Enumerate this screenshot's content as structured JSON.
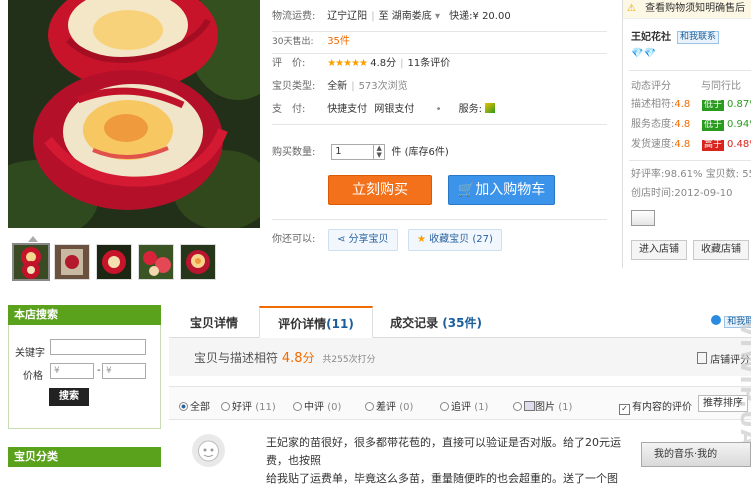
{
  "product": {
    "shipping_label": "物流运费:",
    "shipping_from": "辽宁辽阳",
    "shipping_to_prefix": "至",
    "shipping_to": "湖南娄底",
    "shipping_to_arrow": "▾",
    "shipping_express": "快递:¥ 20.00",
    "sold_label": "30天售出:",
    "sold_value": "35件",
    "rating_label": "评　价:",
    "rating_stars": "★★★★★",
    "rating_score": "4.8分",
    "rating_count": "11条评价",
    "type_label": "宝贝类型:",
    "type_value": "全新",
    "views": "573次浏览",
    "pay_label": "支　付:",
    "pay_1": "快捷支付",
    "pay_2": "网银支付",
    "pay_dot": "•",
    "service_label": "服务:",
    "qty_label": "购买数量:",
    "qty_value": "1",
    "qty_unit": "件",
    "qty_stock": "(库存6件)",
    "buy_now": "立刻购买",
    "add_cart": "加入购物车",
    "also_label": "你还可以:",
    "share": "分享宝贝",
    "favorite": "收藏宝贝 (27)"
  },
  "seller": {
    "notice": "查看购物须知明确售后",
    "shop_name": "王妃花社",
    "contact": "和我联系",
    "diamonds": "💎💎",
    "dynamic_label": "动态评分",
    "compare_label": "与同行比",
    "scores": [
      {
        "label": "描述相符:",
        "score": "4.8",
        "badge": "低于",
        "pct": "0.87%",
        "tone": "green"
      },
      {
        "label": "服务态度:",
        "score": "4.8",
        "badge": "低于",
        "pct": "0.94%",
        "tone": "green"
      },
      {
        "label": "发货速度:",
        "score": "4.8",
        "badge": "高于",
        "pct": "0.48%",
        "tone": "red"
      }
    ],
    "good_rate": "好评率:98.61%",
    "items": "宝贝数: 55",
    "created": "创店时间:2012-09-10",
    "enter_shop": "进入店铺",
    "fav_shop": "收藏店铺"
  },
  "sidebar": {
    "search_title": "本店搜索",
    "keyword_label": "关键字",
    "price_label": "价格",
    "price_ph1": "¥",
    "price_ph2": "¥",
    "price_sep": "-",
    "search_button": "搜索",
    "category_title": "宝贝分类"
  },
  "tabs": {
    "detail": "宝贝详情",
    "reviews_prefix": "评价详情",
    "reviews_count": "(11)",
    "records_prefix": "成交记录",
    "records_count": "(35件)",
    "contact": "和我联"
  },
  "summary": {
    "text": "宝贝与描述相符",
    "score": "4.8",
    "unit": "分",
    "total": "共255次打分",
    "right": "店铺评分"
  },
  "filters": {
    "all": "全部",
    "good": "好评",
    "good_n": "(11)",
    "mid": "中评",
    "mid_n": "(0)",
    "bad": "差评",
    "bad_n": "(0)",
    "add": "追评",
    "add_n": "(1)",
    "pic": "图片",
    "pic_n": "(1)",
    "has_content": "有内容的评价",
    "sort": "推荐排序"
  },
  "review": {
    "line1": "王妃家的苗很好，很多都带花苞的，直接可以验证是否对版。给了20元运费，也按照",
    "line2": "给我贴了运费单，毕竟这么多苗，重量随便昨的也会超重的。送了一个图"
  },
  "music": {
    "label": "我的音乐·我的"
  },
  "watermark": "VIWIP.UA",
  "colors": {
    "accent_orange": "#f06b00",
    "buy": "#f4711b",
    "cart": "#3b94ea",
    "side_green": "#5aa11c"
  }
}
